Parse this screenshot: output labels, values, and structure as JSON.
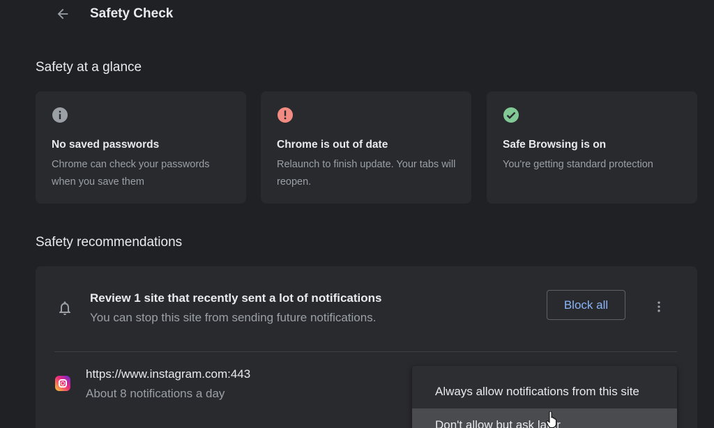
{
  "header": {
    "back_icon": "arrow-back-icon",
    "title": "Safety Check"
  },
  "glance": {
    "heading": "Safety at a glance",
    "cards": [
      {
        "icon": "info-icon",
        "icon_color": "#9aa0a6",
        "title": "No saved passwords",
        "description": "Chrome can check your passwords when you save them"
      },
      {
        "icon": "error-icon",
        "icon_color": "#f28b82",
        "title": "Chrome is out of date",
        "description": "Relaunch to finish update. Your tabs will reopen."
      },
      {
        "icon": "check-circle-icon",
        "icon_color": "#81c995",
        "title": "Safe Browsing is on",
        "description": "You're getting standard protection"
      }
    ]
  },
  "recommendations": {
    "heading": "Safety recommendations",
    "notification_review": {
      "icon": "bell-icon",
      "title": "Review 1 site that recently sent a lot of notifications",
      "description": "You can stop this site from sending future notifications.",
      "block_all_label": "Block all",
      "more_icon": "more-vert-icon"
    },
    "site": {
      "favicon": "instagram-icon",
      "url": "https://www.instagram.com:443",
      "frequency": "About 8 notifications a day"
    },
    "menu": {
      "items": [
        "Always allow notifications from this site",
        "Don't allow but ask later"
      ]
    }
  },
  "colors": {
    "background": "#202124",
    "card": "#292a2d",
    "accent": "#8ab4f8",
    "text_primary": "#e8eaed",
    "text_secondary": "#9aa0a6"
  }
}
